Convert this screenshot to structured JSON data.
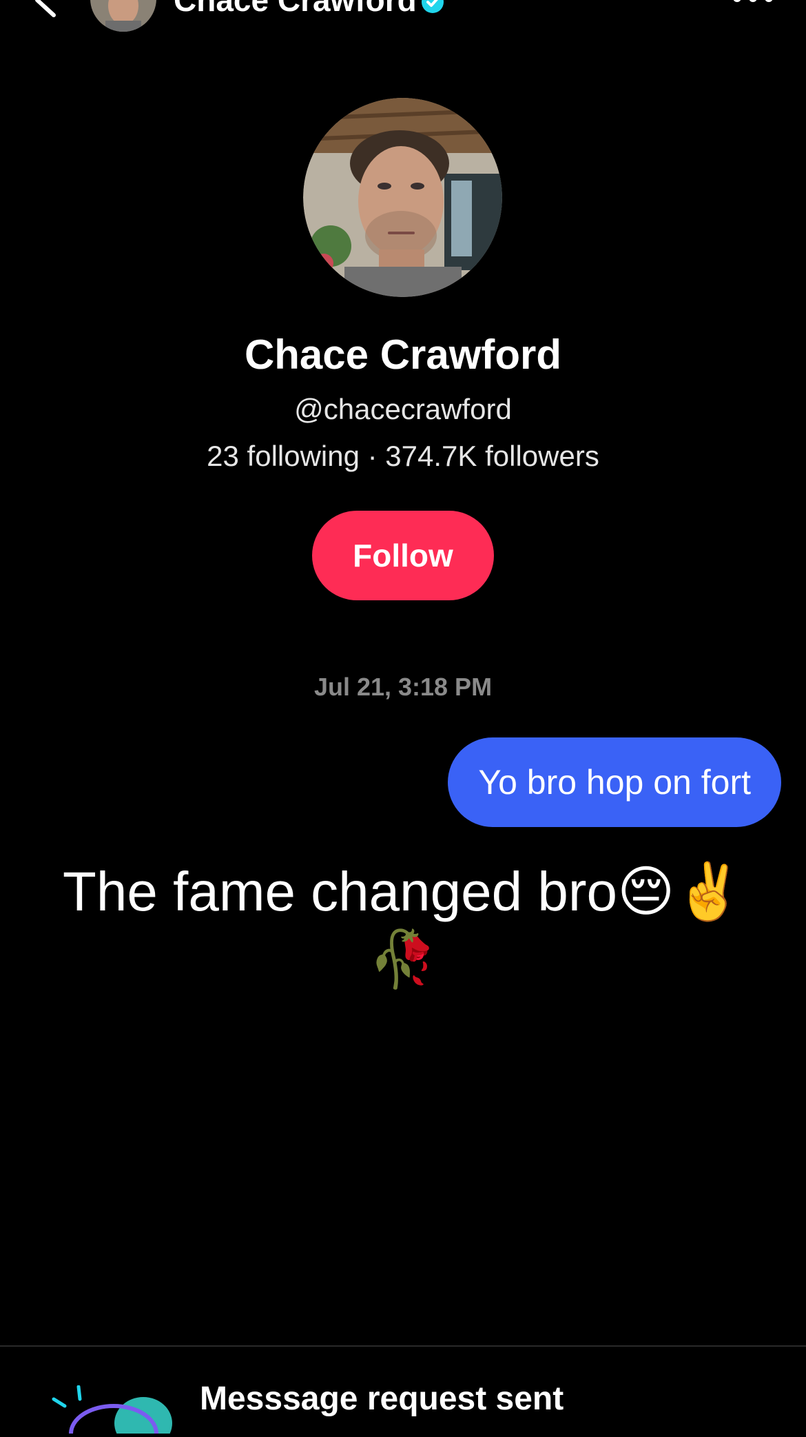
{
  "header": {
    "name": "Chace Crawford",
    "back_icon": "chevron-left-icon",
    "more_icon": "ellipsis-icon",
    "verified_icon": "verified-badge-icon"
  },
  "profile": {
    "name": "Chace Crawford",
    "handle": "@chacecrawford",
    "stats": "23 following · 374.7K followers",
    "follow_label": "Follow"
  },
  "conversation": {
    "timestamp": "Jul 21, 3:18 PM",
    "messages": [
      {
        "from": "me",
        "text": "Yo bro hop on fort"
      },
      {
        "from": "them",
        "text": "The fame changed bro😔✌️🥀"
      }
    ]
  },
  "request_bar": {
    "title": "Messsage request sent",
    "subtitle": ""
  },
  "colors": {
    "background": "#000000",
    "follow_button": "#fe2c55",
    "sent_bubble": "#3a62f6",
    "verified": "#20d5ec",
    "muted_text": "#8a8a8a"
  }
}
